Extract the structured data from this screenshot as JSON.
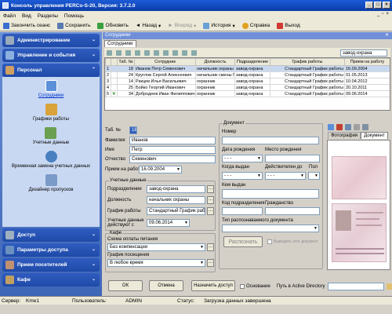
{
  "window": {
    "title": "Консоль управления PERCo-S-20, Версия: 3.7.2.0"
  },
  "menu": [
    "Файл",
    "Вид",
    "Разделы",
    "Помощь"
  ],
  "toolbar": {
    "end_session": "Закончить сеанс",
    "save": "Сохранить",
    "refresh": "Обновить",
    "back": "Назад",
    "forward": "Вперед",
    "history": "История",
    "help": "Справка",
    "exit": "Выход"
  },
  "sidebar": {
    "sections": {
      "admin": "Администрирование",
      "events": "Управление и события",
      "personnel": "Персонал",
      "access": "Доступ",
      "access_params": "Параметры доступа",
      "visitor_reception": "Прием посетителей",
      "cafe": "Кафе"
    },
    "personnel_items": [
      "Сотрудники",
      "Графики работы",
      "Учетные данные",
      "Временная замена учетных данных",
      "Дизайнер пропусков"
    ]
  },
  "document": {
    "window_title": "Сотрудники",
    "tab": "Сотрудники"
  },
  "grid_search": "завод-охрана",
  "grid": {
    "columns": [
      "",
      "",
      "Таб. №",
      "Сотрудник",
      "Должность",
      "Подразделение",
      "График работы",
      "Прием на работу"
    ],
    "rows": [
      {
        "marker": "1",
        "num": "18",
        "name": "Иванов Петр Семенович",
        "position": "начальник охраны",
        "dept": "завод-охрана",
        "schedule": "Стандартный График работы",
        "hired": "16.09.2004",
        "selected": true
      },
      {
        "marker": "2",
        "num": "24",
        "name": "Круглов Сергей Алексеевич",
        "position": "начальник смены ПЦН",
        "dept": "завод-охрана",
        "schedule": "Стандартный График работы",
        "hired": "01.05.2013",
        "selected": false
      },
      {
        "marker": "3",
        "num": "14",
        "name": "Ракцев Илья Васильевич",
        "position": "охранник",
        "dept": "завод-охрана",
        "schedule": "Стандартный График работы",
        "hired": "10.04.2012",
        "selected": false
      },
      {
        "marker": "4",
        "num": "25",
        "name": "Бойко Георгий Иванович",
        "position": "охранник",
        "dept": "завод-охрана",
        "schedule": "Стандартный График работы",
        "hired": "20.10.2011",
        "selected": false
      },
      {
        "marker": "5",
        "num": "34",
        "name": "Добродеев Иван Филиппович",
        "position": "охранник",
        "dept": "завод-охрана",
        "schedule": "Стандартный График работы",
        "hired": "09.06.2014",
        "selected": false
      }
    ]
  },
  "form": {
    "tab_num_label": "Таб. №",
    "tab_num": "18",
    "lastname_label": "Фамилия",
    "lastname": "Иванов",
    "firstname_label": "Имя",
    "firstname": "Петр",
    "patronymic_label": "Отчество",
    "patronymic": "Семенович",
    "hired_label": "Прием на работу",
    "hired": "16.09.2004",
    "account_group": "Учетные данные",
    "dept_label": "Подразделение",
    "dept": "завод-охрана",
    "position_label": "Должность",
    "position": "начальник охраны",
    "schedule_label": "График работы",
    "schedule": "Стандартный График работы",
    "valid_label": "Учетные данные действуют с",
    "valid": "09.06.2014",
    "cafe_group": "Кафе",
    "pay_scheme_label": "Схема оплаты питания",
    "pay_scheme": "Без компенсации",
    "visit_schedule_label": "График посещения",
    "visit_schedule": "В любое время"
  },
  "doc": {
    "group": "Документ",
    "number_label": "Номер",
    "birthdate_label": "Дата рождения",
    "birthplace_label": "Место рождения",
    "birthdate": "- - -",
    "issued_when_label": "Когда выдан",
    "valid_until_label": "Действителен до",
    "sex_label": "Пол",
    "issued_when": "- - -",
    "valid_until": "- - -",
    "issued_by_label": "Кем выдан",
    "dept_code_label": "Код подразделения",
    "citizenship_label": "Гражданство",
    "recog_type_label": "Тип распознаваемого документа",
    "recognize_button": "Распознать",
    "show_label": "Выводить этот документ"
  },
  "photo_tabs": [
    "Фотография",
    "Документ"
  ],
  "footer": {
    "ok": "ОК",
    "cancel": "Отмена",
    "assign": "Назначить доступ",
    "fired_label": "Основание",
    "ad_label": "Путь в Active Directory"
  },
  "status": {
    "server_label": "Сервер:",
    "server": "Kme1",
    "user_label": "Пользователь:",
    "user": "ADMIN",
    "status_label": "Статус:",
    "status": "Загрузка данных завершена"
  }
}
